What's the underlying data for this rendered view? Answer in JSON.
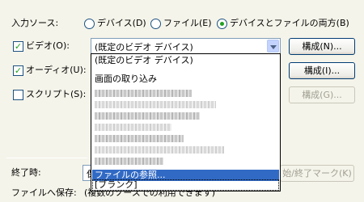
{
  "input_source": {
    "label": "入力ソース:",
    "options": [
      {
        "label": "デバイス(D)",
        "checked": false
      },
      {
        "label": "ファイル(E)",
        "checked": false
      },
      {
        "label": "デバイスとファイルの両方(B)",
        "checked": true
      }
    ]
  },
  "video": {
    "label": "ビデオ(O):",
    "checked": true,
    "value": "(既定のビデオ デバイス)",
    "configure_label": "構成(N)..."
  },
  "audio": {
    "label": "オーディオ(U):",
    "checked": true,
    "configure_label": "構成(I)..."
  },
  "script": {
    "label": "スクリプト(S):",
    "checked": false,
    "configure_label": "構成(G)..."
  },
  "dropdown": {
    "items": [
      "(既定のビデオ デバイス)",
      "画面の取り込み"
    ],
    "selected": "ファイルの参照...",
    "last": "[ブランク]"
  },
  "end_time": {
    "label": "終了時:",
    "field_value": "保",
    "marker_button": "始/終了マーク(K)"
  },
  "save_to_file": {
    "label": "ファイルへ保存:",
    "note": "(複数のソースでの利用できます)"
  },
  "icons": {
    "checkmark": "✓"
  },
  "colors": {
    "selection": "#316ac5",
    "check": "#21a121",
    "dialog_bg": "#f5f4ea"
  }
}
